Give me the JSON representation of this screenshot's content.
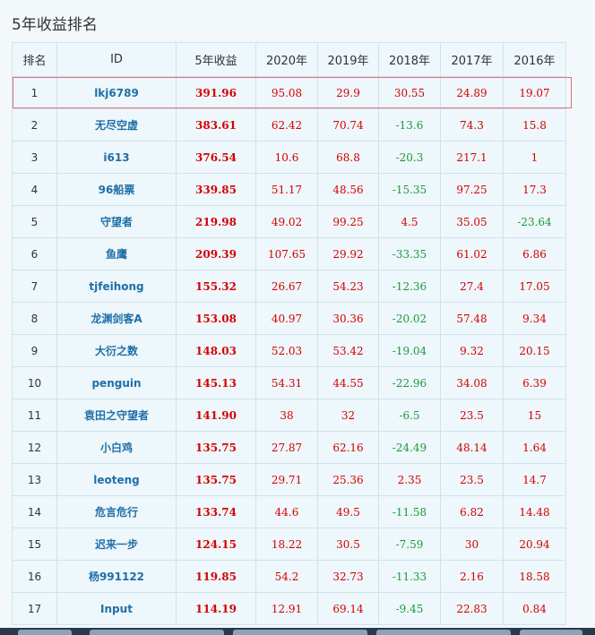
{
  "title": "5年收益排名",
  "headers": [
    "排名",
    "ID",
    "5年收益",
    "2020年",
    "2019年",
    "2018年",
    "2017年",
    "2016年"
  ],
  "rows": [
    {
      "rank": "1",
      "id": "lkj6789",
      "total": "391.96",
      "y2020": "95.08",
      "y2019": "29.9",
      "y2018": "30.55",
      "y2017": "24.89",
      "y2016": "19.07"
    },
    {
      "rank": "2",
      "id": "无尽空虚",
      "total": "383.61",
      "y2020": "62.42",
      "y2019": "70.74",
      "y2018": "-13.6",
      "y2017": "74.3",
      "y2016": "15.8"
    },
    {
      "rank": "3",
      "id": "i613",
      "total": "376.54",
      "y2020": "10.6",
      "y2019": "68.8",
      "y2018": "-20.3",
      "y2017": "217.1",
      "y2016": "1"
    },
    {
      "rank": "4",
      "id": "96船票",
      "total": "339.85",
      "y2020": "51.17",
      "y2019": "48.56",
      "y2018": "-15.35",
      "y2017": "97.25",
      "y2016": "17.3"
    },
    {
      "rank": "5",
      "id": "守望者",
      "total": "219.98",
      "y2020": "49.02",
      "y2019": "99.25",
      "y2018": "4.5",
      "y2017": "35.05",
      "y2016": "-23.64"
    },
    {
      "rank": "6",
      "id": "鱼鹰",
      "total": "209.39",
      "y2020": "107.65",
      "y2019": "29.92",
      "y2018": "-33.35",
      "y2017": "61.02",
      "y2016": "6.86"
    },
    {
      "rank": "7",
      "id": "tjfeihong",
      "total": "155.32",
      "y2020": "26.67",
      "y2019": "54.23",
      "y2018": "-12.36",
      "y2017": "27.4",
      "y2016": "17.05"
    },
    {
      "rank": "8",
      "id": "龙渊剑客A",
      "total": "153.08",
      "y2020": "40.97",
      "y2019": "30.36",
      "y2018": "-20.02",
      "y2017": "57.48",
      "y2016": "9.34"
    },
    {
      "rank": "9",
      "id": "大衍之数",
      "total": "148.03",
      "y2020": "52.03",
      "y2019": "53.42",
      "y2018": "-19.04",
      "y2017": "9.32",
      "y2016": "20.15"
    },
    {
      "rank": "10",
      "id": "penguin",
      "total": "145.13",
      "y2020": "54.31",
      "y2019": "44.55",
      "y2018": "-22.96",
      "y2017": "34.08",
      "y2016": "6.39"
    },
    {
      "rank": "11",
      "id": "袁田之守望者",
      "total": "141.90",
      "y2020": "38",
      "y2019": "32",
      "y2018": "-6.5",
      "y2017": "23.5",
      "y2016": "15"
    },
    {
      "rank": "12",
      "id": "小白鸡",
      "total": "135.75",
      "y2020": "27.87",
      "y2019": "62.16",
      "y2018": "-24.49",
      "y2017": "48.14",
      "y2016": "1.64"
    },
    {
      "rank": "13",
      "id": "leoteng",
      "total": "135.75",
      "y2020": "29.71",
      "y2019": "25.36",
      "y2018": "2.35",
      "y2017": "23.5",
      "y2016": "14.7"
    },
    {
      "rank": "14",
      "id": "危言危行",
      "total": "133.74",
      "y2020": "44.6",
      "y2019": "49.5",
      "y2018": "-11.58",
      "y2017": "6.82",
      "y2016": "14.48"
    },
    {
      "rank": "15",
      "id": "迟来一步",
      "total": "124.15",
      "y2020": "18.22",
      "y2019": "30.5",
      "y2018": "-7.59",
      "y2017": "30",
      "y2016": "20.94"
    },
    {
      "rank": "16",
      "id": "杨991122",
      "total": "119.85",
      "y2020": "54.2",
      "y2019": "32.73",
      "y2018": "-11.33",
      "y2017": "2.16",
      "y2016": "18.58"
    },
    {
      "rank": "17",
      "id": "Input",
      "total": "114.19",
      "y2020": "12.91",
      "y2019": "69.14",
      "y2018": "-9.45",
      "y2017": "22.83",
      "y2016": "0.84"
    }
  ],
  "colors": {
    "positive": "#d40000",
    "negative": "#1a9a3a",
    "link": "#1f6fa8",
    "highlight_border": "#e0707a"
  }
}
